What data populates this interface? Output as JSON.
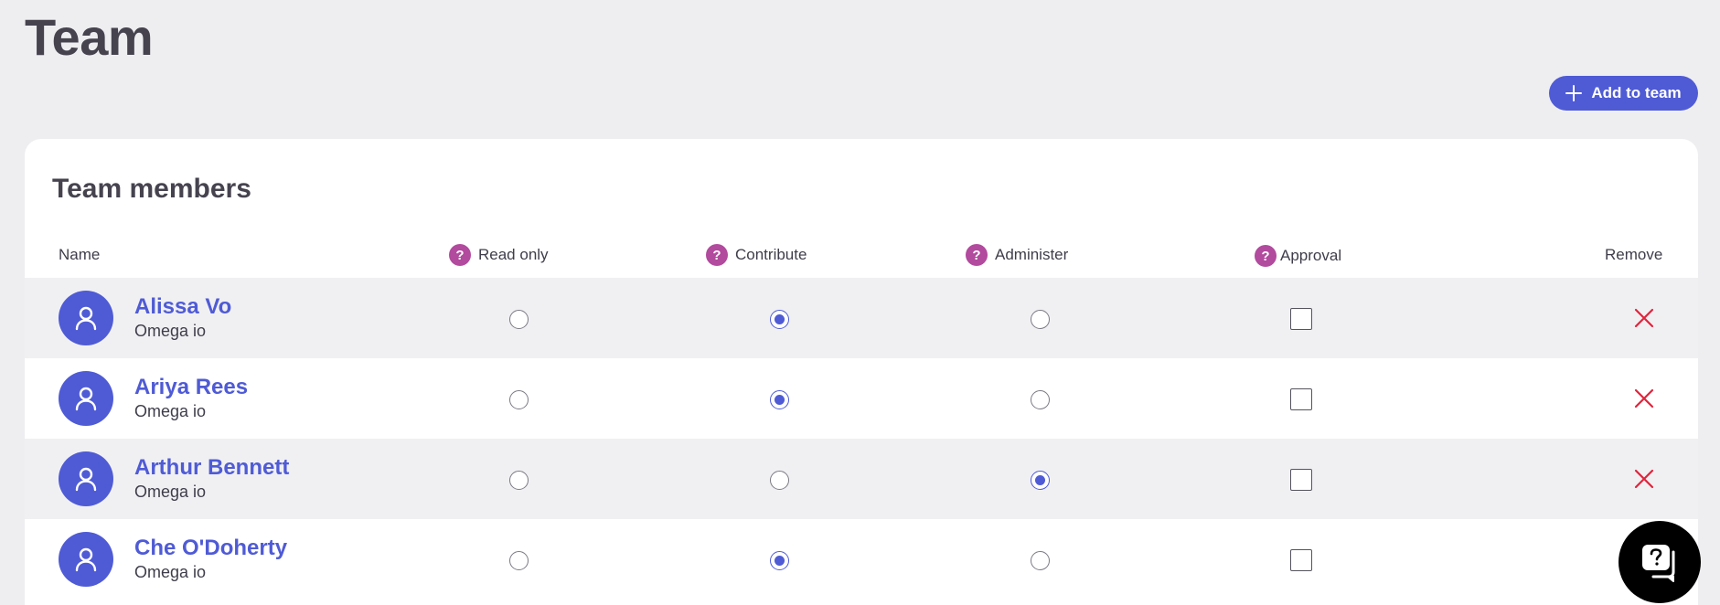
{
  "page": {
    "title": "Team"
  },
  "actions": {
    "add_label": "Add to team"
  },
  "card": {
    "title": "Team members"
  },
  "columns": {
    "name": "Name",
    "read_only": "Read only",
    "contribute": "Contribute",
    "administer": "Administer",
    "approval": "Approval",
    "remove": "Remove",
    "help_glyph": "?"
  },
  "members": [
    {
      "name": "Alissa Vo",
      "org": "Omega io",
      "role": "Contribute",
      "approval": false
    },
    {
      "name": "Ariya Rees",
      "org": "Omega io",
      "role": "Contribute",
      "approval": false
    },
    {
      "name": "Arthur Bennett",
      "org": "Omega io",
      "role": "Administer",
      "approval": false
    },
    {
      "name": "Che O'Doherty",
      "org": "Omega io",
      "role": "Contribute",
      "approval": false
    }
  ],
  "colors": {
    "accent": "#4f5bd5",
    "help": "#b24a9e",
    "remove": "#e0243b",
    "row_shade": "#f0f0f3",
    "background": "#eeeef1"
  },
  "icons": {
    "add": "plus-icon",
    "help": "question-icon",
    "avatar": "user-icon",
    "remove": "close-icon",
    "chat": "chat-icon"
  }
}
